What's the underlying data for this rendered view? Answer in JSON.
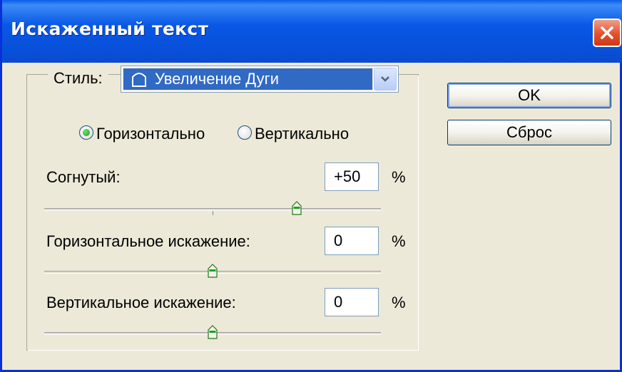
{
  "window": {
    "title": "Искаженный текст"
  },
  "style": {
    "label": "Стиль:",
    "selected": "Увеличение Дуги"
  },
  "orientation": {
    "options": [
      "Горизонтально",
      "Вертикально"
    ],
    "selected": "Горизонтально"
  },
  "bend": {
    "label": "Согнутый:",
    "value": "+50",
    "unit": "%",
    "slider_value": 50,
    "range": [
      -100,
      100
    ]
  },
  "horizontal_distortion": {
    "label": "Горизонтальное искажение:",
    "value": "0",
    "unit": "%",
    "slider_value": 0,
    "range": [
      -100,
      100
    ]
  },
  "vertical_distortion": {
    "label": "Вертикальное искажение:",
    "value": "0",
    "unit": "%",
    "slider_value": 0,
    "range": [
      -100,
      100
    ]
  },
  "buttons": {
    "ok": "OK",
    "reset": "Сброс"
  },
  "colors": {
    "title_bar": "#0a57e6",
    "selection": "#316ac5",
    "close": "#e2502c",
    "dialog_bg": "#ece9d8",
    "thumb_green": "#21a121"
  },
  "icons": {
    "close": "close-icon",
    "dropdown": "chevron-down-icon",
    "style": "arc-shape-icon"
  }
}
